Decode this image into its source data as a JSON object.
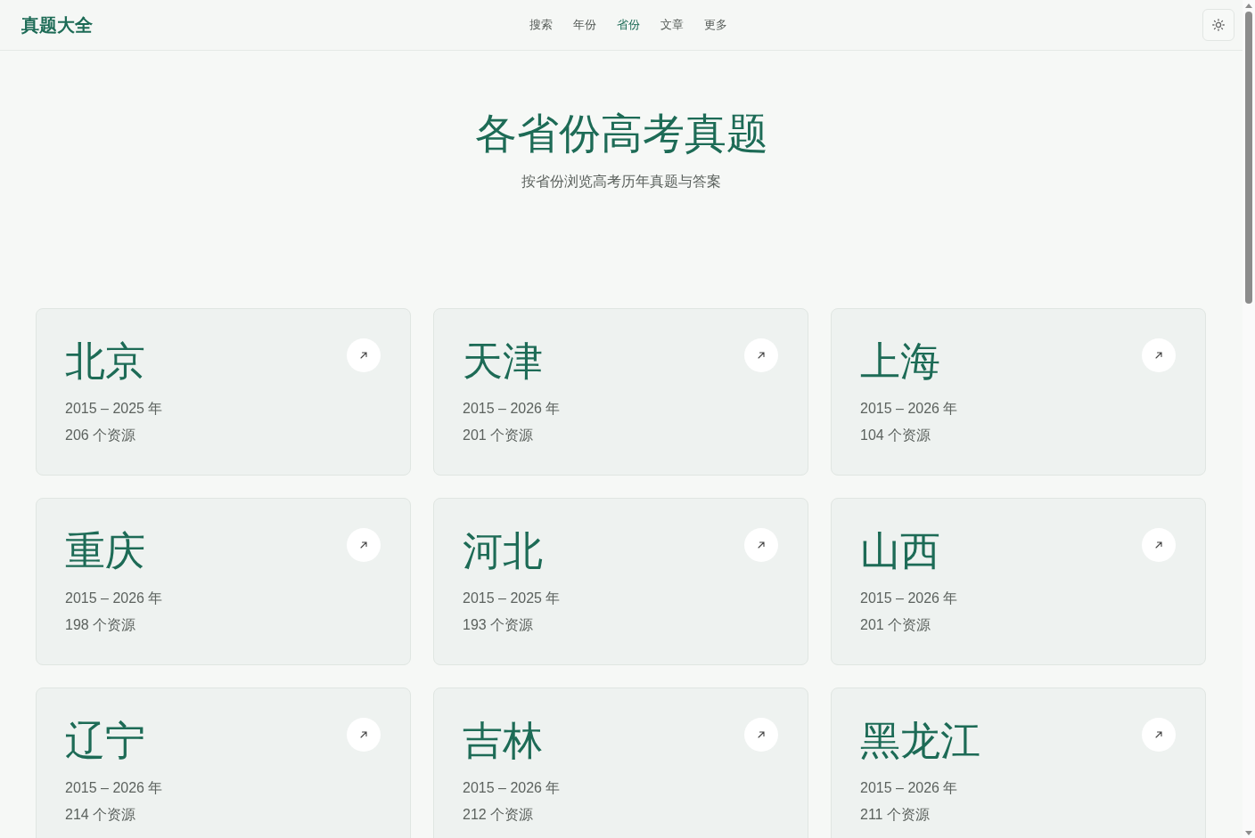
{
  "header": {
    "logo": "真题大全",
    "nav": [
      {
        "label": "搜索",
        "selected": false
      },
      {
        "label": "年份",
        "selected": false
      },
      {
        "label": "省份",
        "selected": true
      },
      {
        "label": "文章",
        "selected": false
      },
      {
        "label": "更多",
        "selected": false
      }
    ]
  },
  "hero": {
    "title": "各省份高考真题",
    "subtitle": "按省份浏览高考历年真题与答案"
  },
  "provinces": [
    {
      "name": "北京",
      "years": "2015 – 2025 年",
      "resources": "206 个资源"
    },
    {
      "name": "天津",
      "years": "2015 – 2026 年",
      "resources": "201 个资源"
    },
    {
      "name": "上海",
      "years": "2015 – 2026 年",
      "resources": "104 个资源"
    },
    {
      "name": "重庆",
      "years": "2015 – 2026 年",
      "resources": "198 个资源"
    },
    {
      "name": "河北",
      "years": "2015 – 2025 年",
      "resources": "193 个资源"
    },
    {
      "name": "山西",
      "years": "2015 – 2026 年",
      "resources": "201 个资源"
    },
    {
      "name": "辽宁",
      "years": "2015 – 2026 年",
      "resources": "214 个资源"
    },
    {
      "name": "吉林",
      "years": "2015 – 2026 年",
      "resources": "212 个资源"
    },
    {
      "name": "黑龙江",
      "years": "2015 – 2026 年",
      "resources": "211 个资源"
    }
  ]
}
